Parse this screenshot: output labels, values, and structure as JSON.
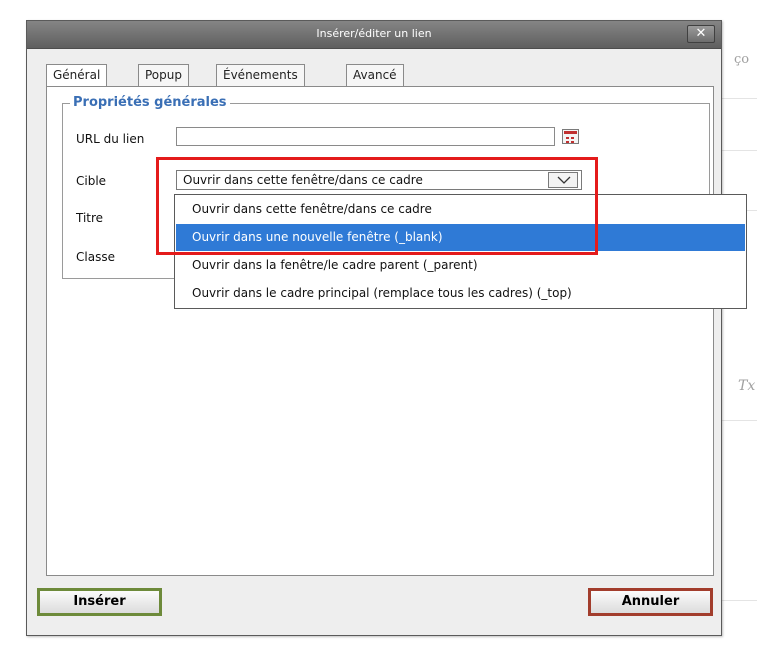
{
  "dialog": {
    "title": "Insérer/éditer un lien",
    "close_glyph": "✕"
  },
  "tabs": [
    {
      "label": "Général",
      "active": true
    },
    {
      "label": "Popup",
      "active": false
    },
    {
      "label": "Événements",
      "active": false
    },
    {
      "label": "Avancé",
      "active": false
    }
  ],
  "general": {
    "section_title": "Propriétés générales",
    "url_label": "URL du lien",
    "url_value": "",
    "target_label": "Cible",
    "target_selected": "Ouvrir dans cette fenêtre/dans ce cadre",
    "title_label": "Titre",
    "class_label": "Classe"
  },
  "dropdown": {
    "options": [
      "Ouvrir dans cette fenêtre/dans ce cadre",
      "Ouvrir dans une nouvelle fenêtre (_blank)",
      "Ouvrir dans la fenêtre/le cadre parent (_parent)",
      "Ouvrir dans le cadre principal (remplace tous les cadres) (_top)"
    ],
    "highlighted_index": 1
  },
  "buttons": {
    "insert": "Insérer",
    "cancel": "Annuler"
  },
  "background": {
    "glyphs": [
      "ço",
      "Tx"
    ]
  },
  "colors": {
    "selection": "#2f7ad6",
    "annotation": "#e41b1b",
    "legend": "#3a6fb5"
  },
  "icons": {
    "picker": "link-browser-icon",
    "dropdown": "chevron-down-icon",
    "close": "close-icon"
  }
}
